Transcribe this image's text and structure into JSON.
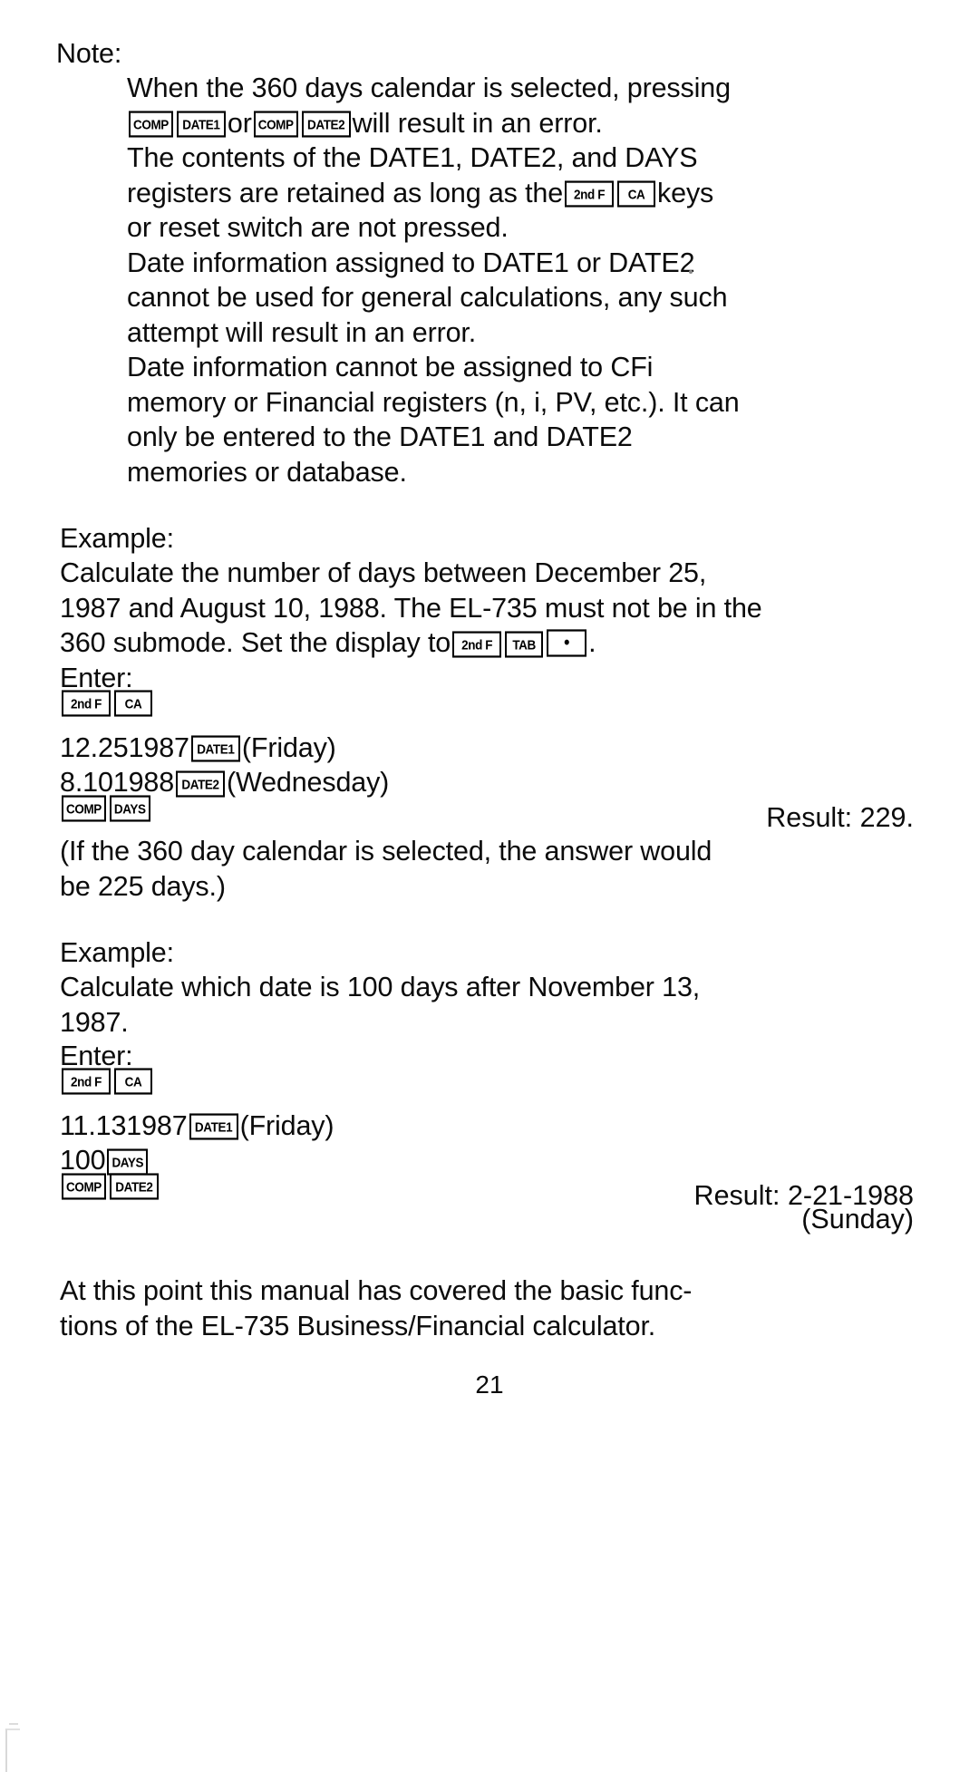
{
  "document": {
    "page_number": "21",
    "product": "EL-735"
  },
  "note": {
    "heading": "Note:",
    "items": [
      {
        "lines": [
          {
            "segments": [
              {
                "type": "text",
                "value": "When the 360 days calendar is selected, pressing"
              }
            ]
          },
          {
            "segments": [
              {
                "type": "key",
                "value": "COMP"
              },
              {
                "type": "key",
                "value": "DATE1"
              },
              {
                "type": "text",
                "value": " or "
              },
              {
                "type": "key",
                "value": "COMP"
              },
              {
                "type": "key",
                "value": "DATE2"
              },
              {
                "type": "text",
                "value": " will result in an error."
              }
            ]
          }
        ]
      },
      {
        "lines": [
          {
            "segments": [
              {
                "type": "text",
                "value": "The contents of the DATE1, DATE2, and DAYS"
              }
            ]
          },
          {
            "segments": [
              {
                "type": "text",
                "value": "registers are retained as long as the "
              },
              {
                "type": "key",
                "value": "2nd F"
              },
              {
                "type": "key",
                "value": "CA"
              },
              {
                "type": "text",
                "value": " keys"
              }
            ]
          },
          {
            "segments": [
              {
                "type": "text",
                "value": "or reset switch are not pressed."
              }
            ]
          }
        ]
      },
      {
        "lines": [
          {
            "segments": [
              {
                "type": "text",
                "value": "Date information assigned to DATE1 or DATE2"
              }
            ]
          },
          {
            "segments": [
              {
                "type": "text",
                "value": "cannot be used for general calculations, any such"
              }
            ]
          },
          {
            "segments": [
              {
                "type": "text",
                "value": "attempt will result in an error."
              }
            ]
          }
        ]
      },
      {
        "lines": [
          {
            "segments": [
              {
                "type": "text",
                "value": "Date information cannot be assigned to CFi"
              }
            ]
          },
          {
            "segments": [
              {
                "type": "text",
                "value": "memory or Financial registers (n, i, PV, etc.). It can"
              }
            ]
          },
          {
            "segments": [
              {
                "type": "text",
                "value": "only be entered to the DATE1 and DATE2"
              }
            ]
          },
          {
            "segments": [
              {
                "type": "text",
                "value": "memories or database."
              }
            ]
          }
        ]
      }
    ]
  },
  "example1": {
    "heading": "Example:",
    "problem_lines": [
      {
        "segments": [
          {
            "type": "text",
            "value": "Calculate the number of days between December 25,"
          }
        ]
      },
      {
        "segments": [
          {
            "type": "text",
            "value": "1987 and August 10, 1988. The EL-735 must not be in the"
          }
        ]
      },
      {
        "segments": [
          {
            "type": "text",
            "value": "360 submode. Set the display to "
          },
          {
            "type": "key",
            "value": "2nd F"
          },
          {
            "type": "key",
            "value": "TAB"
          },
          {
            "type": "key",
            "value": "•"
          },
          {
            "type": "text",
            "value": "."
          }
        ]
      }
    ],
    "enter_label": "Enter:",
    "keystrokes": [
      {
        "segments": [
          {
            "type": "key",
            "value": "2nd F"
          },
          {
            "type": "key",
            "value": "CA"
          }
        ],
        "result": ""
      },
      {
        "segments": [
          {
            "type": "text",
            "value": "12.251987 "
          },
          {
            "type": "key",
            "value": "DATE1"
          },
          {
            "type": "text",
            "value": " (Friday)"
          }
        ],
        "result": ""
      },
      {
        "segments": [
          {
            "type": "text",
            "value": "8.101988 "
          },
          {
            "type": "key",
            "value": "DATE2"
          },
          {
            "type": "text",
            "value": " (Wednesday)"
          }
        ],
        "result": ""
      },
      {
        "segments": [
          {
            "type": "key",
            "value": "COMP"
          },
          {
            "type": "key",
            "value": "DAYS"
          }
        ],
        "result": "Result: 229."
      }
    ],
    "footnote_lines": [
      {
        "segments": [
          {
            "type": "text",
            "value": "(If the 360 day calendar is selected, the answer would"
          }
        ]
      },
      {
        "segments": [
          {
            "type": "text",
            "value": "be 225 days.)"
          }
        ]
      }
    ]
  },
  "example2": {
    "heading": "Example:",
    "problem_lines": [
      {
        "segments": [
          {
            "type": "text",
            "value": "Calculate which date is 100 days after November 13,"
          }
        ]
      },
      {
        "segments": [
          {
            "type": "text",
            "value": "1987."
          }
        ]
      }
    ],
    "enter_label": "Enter:",
    "keystrokes": [
      {
        "segments": [
          {
            "type": "key",
            "value": "2nd F"
          },
          {
            "type": "key",
            "value": "CA"
          }
        ],
        "result": ""
      },
      {
        "segments": [
          {
            "type": "text",
            "value": "11.131987 "
          },
          {
            "type": "key",
            "value": "DATE1"
          },
          {
            "type": "text",
            "value": " (Friday)"
          }
        ],
        "result": ""
      },
      {
        "segments": [
          {
            "type": "text",
            "value": "100 "
          },
          {
            "type": "key",
            "value": "DAYS"
          }
        ],
        "result": ""
      },
      {
        "segments": [
          {
            "type": "key",
            "value": "COMP"
          },
          {
            "type": "key",
            "value": "DATE2"
          }
        ],
        "result": "Result: 2-21-1988"
      }
    ],
    "result_weekday": "(Sunday)"
  },
  "closing": {
    "lines": [
      {
        "segments": [
          {
            "type": "text",
            "value": "At this point this manual has covered the basic func-"
          }
        ]
      },
      {
        "segments": [
          {
            "type": "text",
            "value": "tions of the EL-735 Business/Financial calculator."
          }
        ]
      }
    ]
  }
}
